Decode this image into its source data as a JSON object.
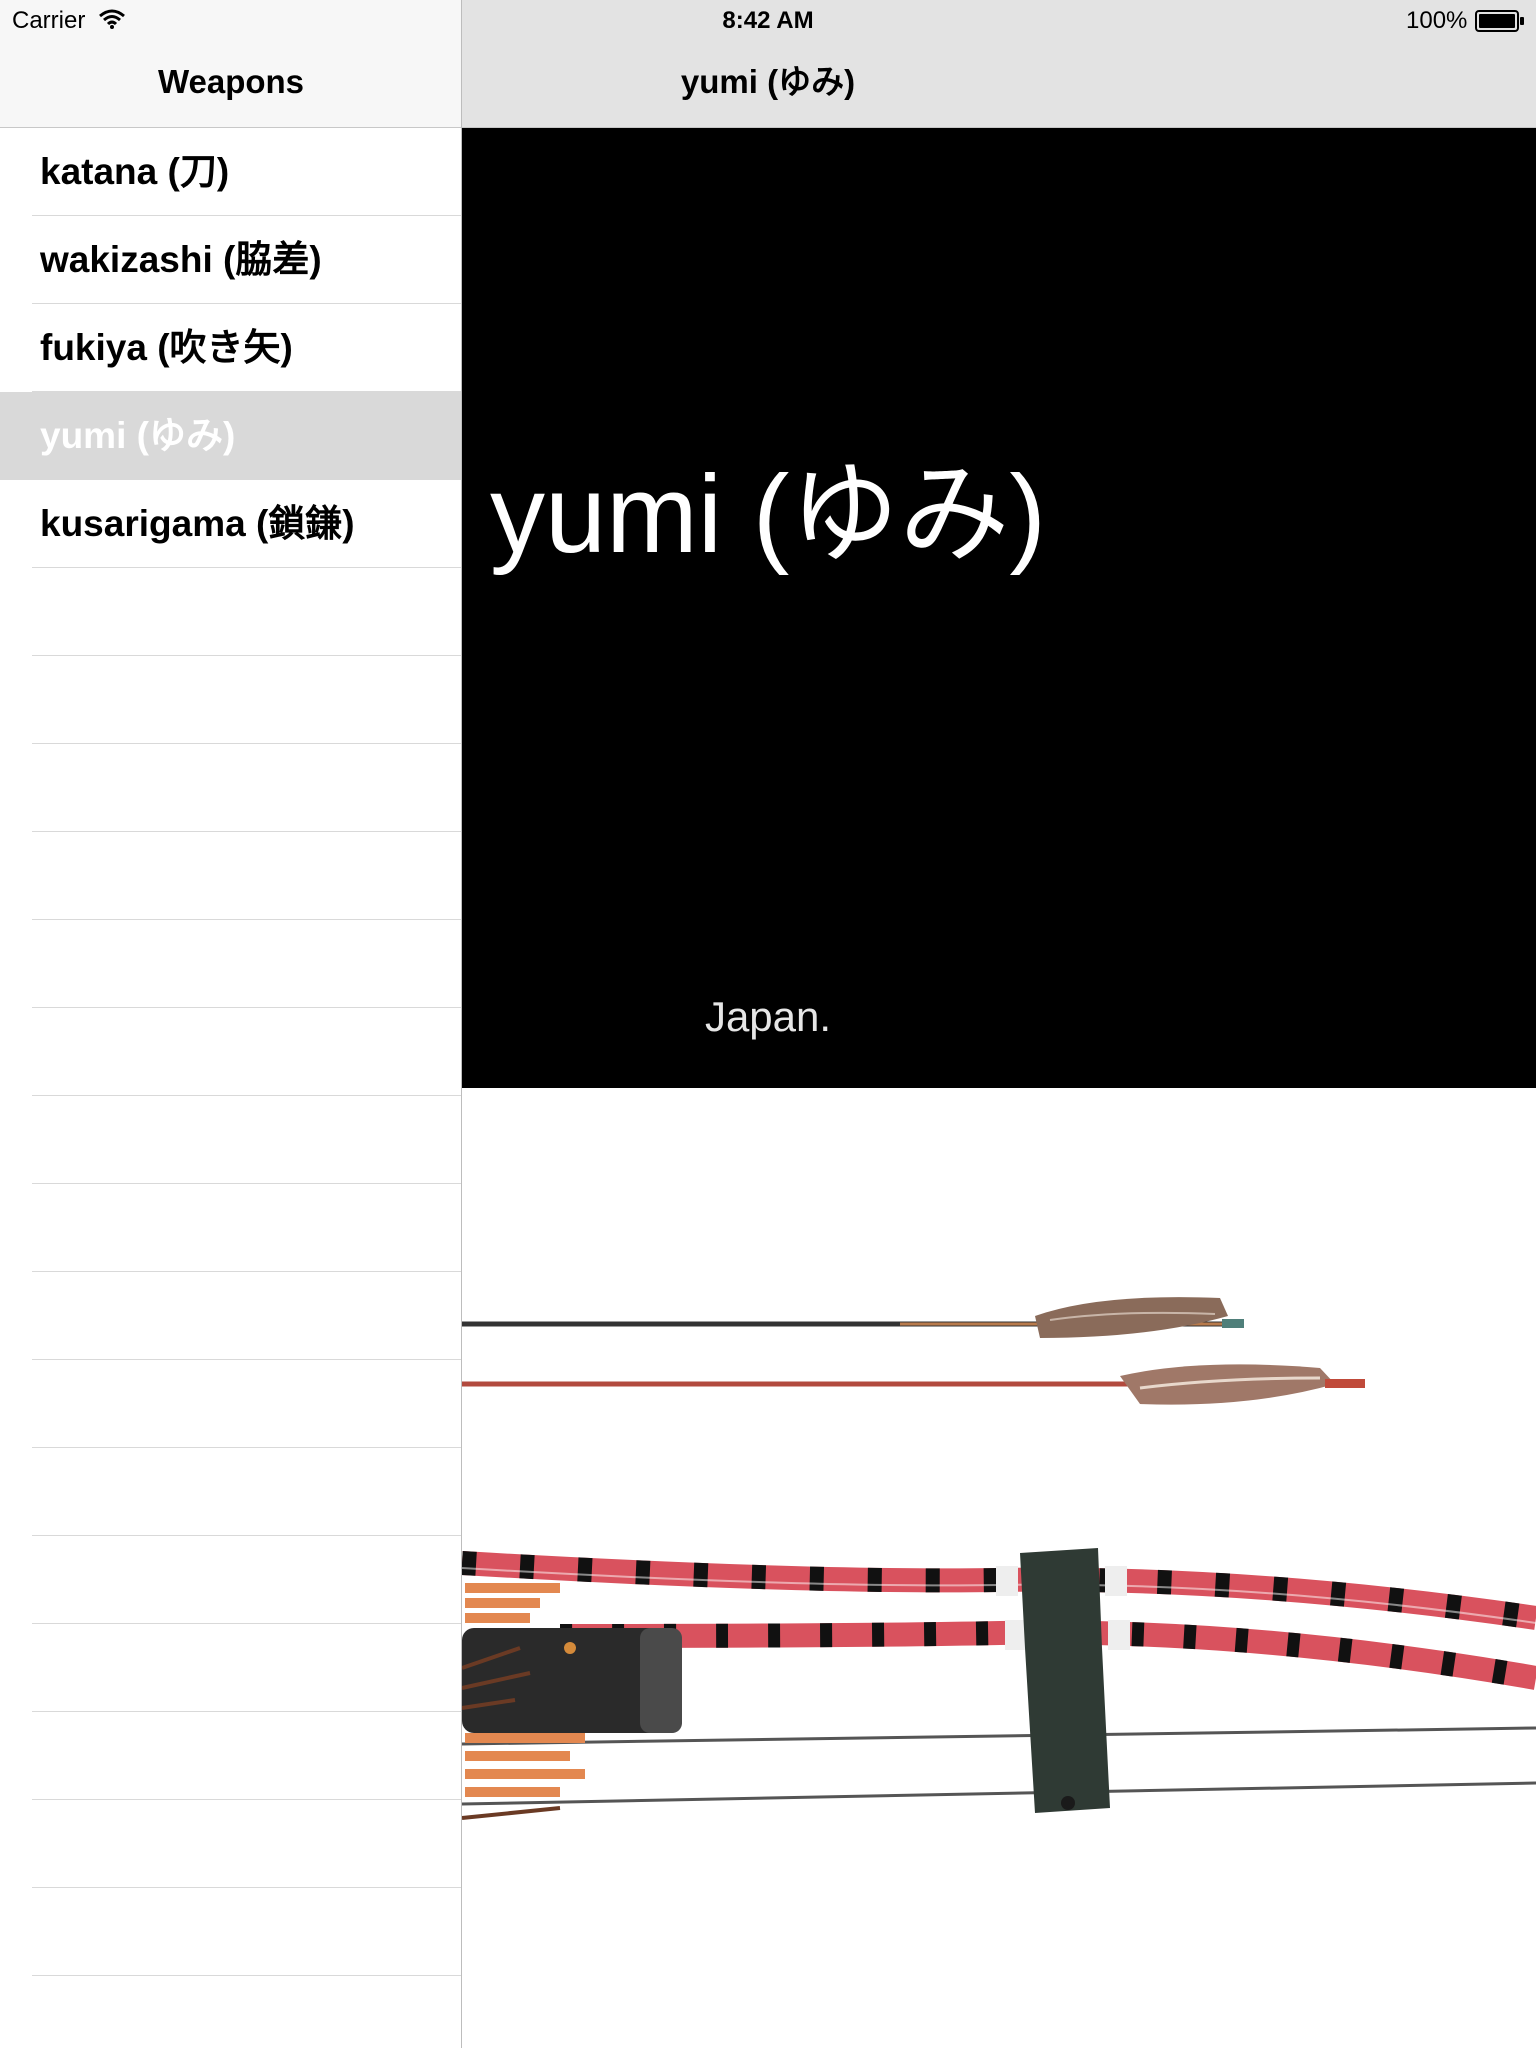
{
  "status_bar": {
    "carrier": "Carrier",
    "time": "8:42 AM",
    "battery": "100%"
  },
  "master": {
    "title": "Weapons",
    "items": [
      {
        "label": "katana (刀)",
        "selected": false
      },
      {
        "label": "wakizashi (脇差)",
        "selected": false
      },
      {
        "label": "fukiya (吹き矢)",
        "selected": false
      },
      {
        "label": "yumi (ゆみ)",
        "selected": true
      },
      {
        "label": "kusarigama (鎖鎌)",
        "selected": false
      }
    ],
    "empty_rows": 17
  },
  "detail": {
    "title": "yumi (ゆみ)",
    "heading": "yumi (ゆみ)",
    "caption": "Japan.",
    "image_icon": "bow-and-arrows-photo"
  }
}
